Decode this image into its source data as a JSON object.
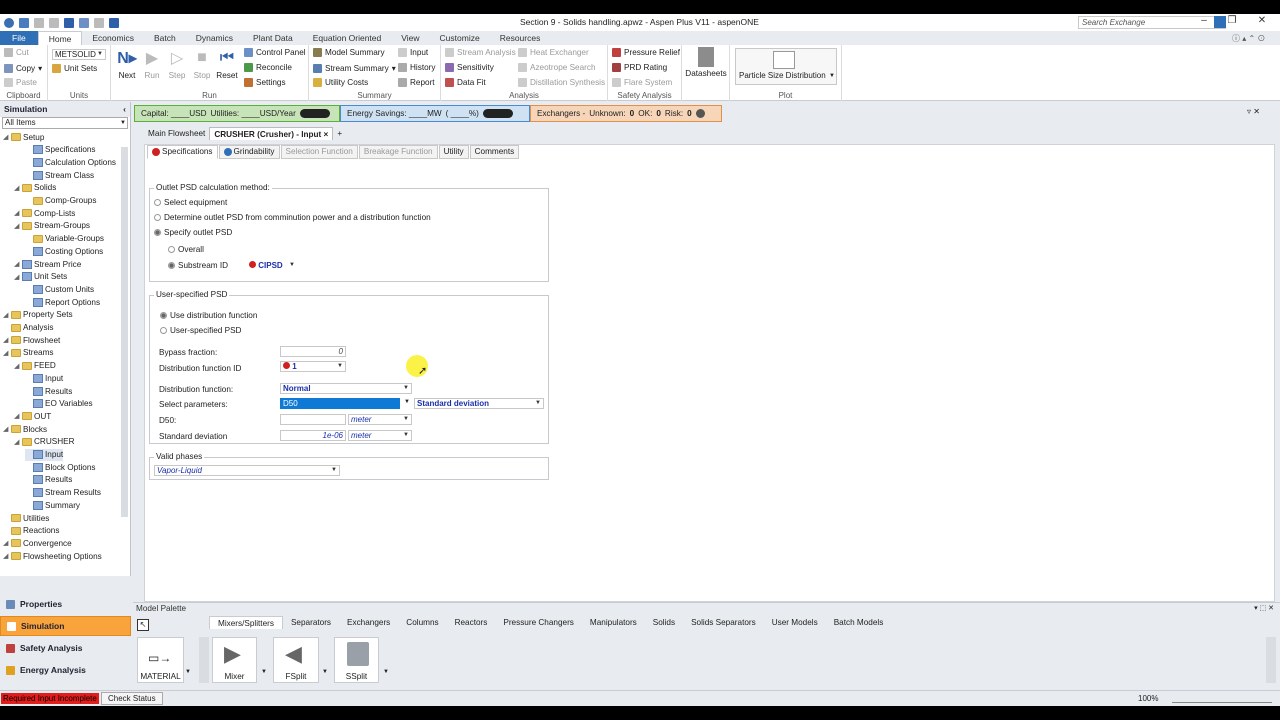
{
  "title": "Section 9 - Solids handling.apwz - Aspen Plus V11 - aspenONE",
  "search_exchange": "Search Exchange",
  "menu": [
    "File",
    "Home",
    "Economics",
    "Batch",
    "Dynamics",
    "Plant Data",
    "Equation Oriented",
    "View",
    "Customize",
    "Resources"
  ],
  "ribbon": {
    "clipboard": {
      "cut": "Cut",
      "copy": "Copy",
      "paste": "Paste",
      "label": "Clipboard"
    },
    "units": {
      "set": "METSOLID",
      "unit_sets": "Unit Sets",
      "label": "Units"
    },
    "run": {
      "next": "Next",
      "run": "Run",
      "step": "Step",
      "stop": "Stop",
      "reset": "Reset",
      "control_panel": "Control Panel",
      "reconcile": "Reconcile",
      "settings": "Settings",
      "label": "Run"
    },
    "summary": {
      "model_summary": "Model Summary",
      "stream_summary": "Stream Summary",
      "utility_costs": "Utility Costs",
      "input": "Input",
      "history": "History",
      "report": "Report",
      "label": "Summary"
    },
    "analysis": {
      "stream_analysis": "Stream Analysis",
      "sensitivity": "Sensitivity",
      "data_fit": "Data Fit",
      "heat_exchanger": "Heat Exchanger",
      "azeotrope_search": "Azeotrope Search",
      "distillation_synthesis": "Distillation Synthesis",
      "label": "Analysis"
    },
    "safety": {
      "pressure_relief": "Pressure Relief",
      "prd_rating": "PRD Rating",
      "flare_system": "Flare System",
      "label": "Safety Analysis"
    },
    "datasheets": "Datasheets",
    "plot": {
      "psd": "Particle Size Distribution",
      "label": "Plot"
    }
  },
  "nav": {
    "title": "Simulation",
    "filter": "All Items",
    "tree": [
      "Setup",
      "Specifications",
      "Calculation Options",
      "Stream Class",
      "Solids",
      "Comp-Groups",
      "Comp-Lists",
      "Stream-Groups",
      "Variable-Groups",
      "Costing Options",
      "Stream Price",
      "Unit Sets",
      "Custom Units",
      "Report Options",
      "Property Sets",
      "Analysis",
      "Flowsheet",
      "Streams",
      "FEED",
      "Input",
      "Results",
      "EO Variables",
      "OUT",
      "Blocks",
      "CRUSHER",
      "Input",
      "Block Options",
      "Results",
      "Stream Results",
      "Summary",
      "Utilities",
      "Reactions",
      "Convergence",
      "Flowsheeting Options"
    ],
    "buttons": [
      "Properties",
      "Simulation",
      "Safety Analysis",
      "Energy Analysis"
    ]
  },
  "cost": {
    "capital": "Capital: ____USD",
    "utilities": "Utilities: ____USD/Year",
    "energy": "Energy Savings: ____MW",
    "energy_pct": "( ____%)",
    "exchangers": "Exchangers -",
    "unknown_label": "Unknown:",
    "unknown": "0",
    "ok_label": "OK:",
    "ok": "0",
    "risk_label": "Risk:",
    "risk": "0"
  },
  "doc_tabs": [
    "Main Flowsheet",
    "CRUSHER (Crusher) - Input"
  ],
  "subtabs": [
    "Specifications",
    "Grindability",
    "Selection Function",
    "Breakage Function",
    "Utility",
    "Comments"
  ],
  "form": {
    "outlet_title": "Outlet PSD calculation method:",
    "opt_select": "Select equipment",
    "opt_determine": "Determine outlet PSD from comminution power and a distribution function",
    "opt_specify": "Specify outlet PSD",
    "opt_overall": "Overall",
    "opt_substream": "Substream ID",
    "substream_val": "CIPSD",
    "user_psd_title": "User-specified PSD",
    "opt_use_dist": "Use distribution function",
    "opt_user_psd": "User-specified PSD",
    "bypass_label": "Bypass fraction:",
    "bypass_val": "0",
    "dist_id_label": "Distribution function ID",
    "dist_id_val": "1",
    "dist_func_label": "Distribution function:",
    "dist_func_val": "Normal",
    "select_params_label": "Select parameters:",
    "select_params_val": "D50",
    "select_params_val2": "Standard deviation",
    "d50_label": "D50:",
    "d50_unit": "meter",
    "std_label": "Standard deviation",
    "std_val": "1e-06",
    "std_unit": "meter",
    "valid_title": "Valid phases",
    "valid_val": "Vapor-Liquid"
  },
  "palette": {
    "title": "Model Palette",
    "tabs": [
      "Mixers/Splitters",
      "Separators",
      "Exchangers",
      "Columns",
      "Reactors",
      "Pressure Changers",
      "Manipulators",
      "Solids",
      "Solids Separators",
      "User Models",
      "Batch Models"
    ],
    "models": [
      "MATERIAL",
      "Mixer",
      "FSplit",
      "SSplit"
    ]
  },
  "status": {
    "required": "Required Input Incomplete",
    "check": "Check Status",
    "zoom": "100%"
  }
}
